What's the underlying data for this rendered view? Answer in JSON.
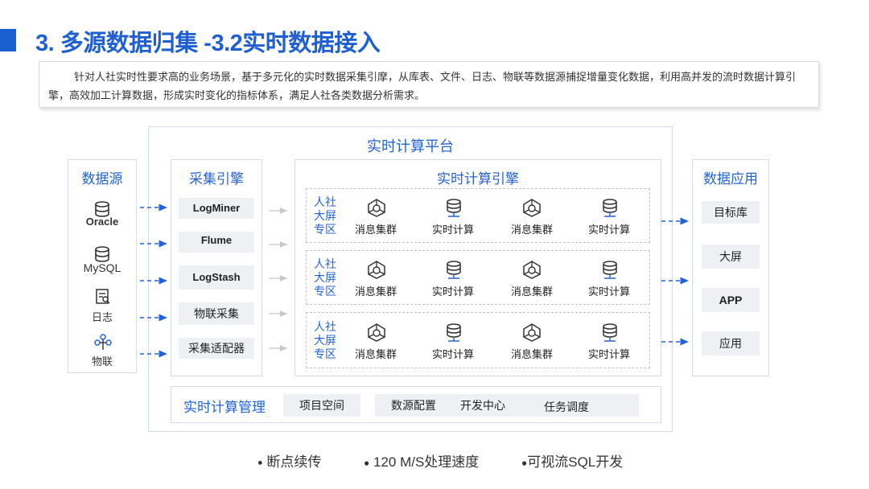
{
  "slide": {
    "title": "3. 多源数据归集 -3.2实时数据接入",
    "description": "针对人社实时性要求高的业务场景，基于多元化的实时数据采集引摩，从库表、文件、日志、物联等数据源捕捉增量变化数据，利用高并发的流时数据计算引擎，高效加工计算数据，形成实时变化的指标体系，满足人社各类数据分析需求。"
  },
  "platform": {
    "title": "实时计算平台"
  },
  "sources": {
    "title": "数据源",
    "items": [
      {
        "label": "Oracle",
        "icon": "database-icon"
      },
      {
        "label": "MySQL",
        "icon": "database-icon"
      },
      {
        "label": "日志",
        "icon": "log-file-icon"
      },
      {
        "label": "物联",
        "icon": "iot-network-icon"
      }
    ]
  },
  "collect": {
    "title": "采集引擎",
    "items": [
      "LogMiner",
      "Flume",
      "LogStash",
      "物联采集",
      "采集适配器"
    ]
  },
  "compute": {
    "title": "实时计算引擎",
    "lanes": [
      {
        "zone": [
          "人社",
          "大屏",
          "专区"
        ],
        "nodes": [
          "消息集群",
          "实时计算",
          "消息集群",
          "实时计算"
        ]
      },
      {
        "zone": [
          "人社",
          "大屏",
          "专区"
        ],
        "nodes": [
          "消息集群",
          "实时计算",
          "消息集群",
          "实时计算"
        ]
      },
      {
        "zone": [
          "人社",
          "大屏",
          "专区"
        ],
        "nodes": [
          "消息集群",
          "实时计算",
          "消息集群",
          "实时计算"
        ]
      }
    ]
  },
  "apps": {
    "title": "数据应用",
    "items": [
      "目标库",
      "大屏",
      "APP",
      "应用"
    ]
  },
  "management": {
    "title": "实时计算管理",
    "items": [
      "项目空间",
      "数源配置",
      "开发中心",
      "任务调度"
    ]
  },
  "features": [
    "断点续传",
    "120 M/S处理速度",
    "可视流SQL开发"
  ],
  "colors": {
    "accent": "#2463d6",
    "title": "#1f5fd1",
    "panel_border": "#d4dcea",
    "item_bg": "#eef0f3"
  }
}
